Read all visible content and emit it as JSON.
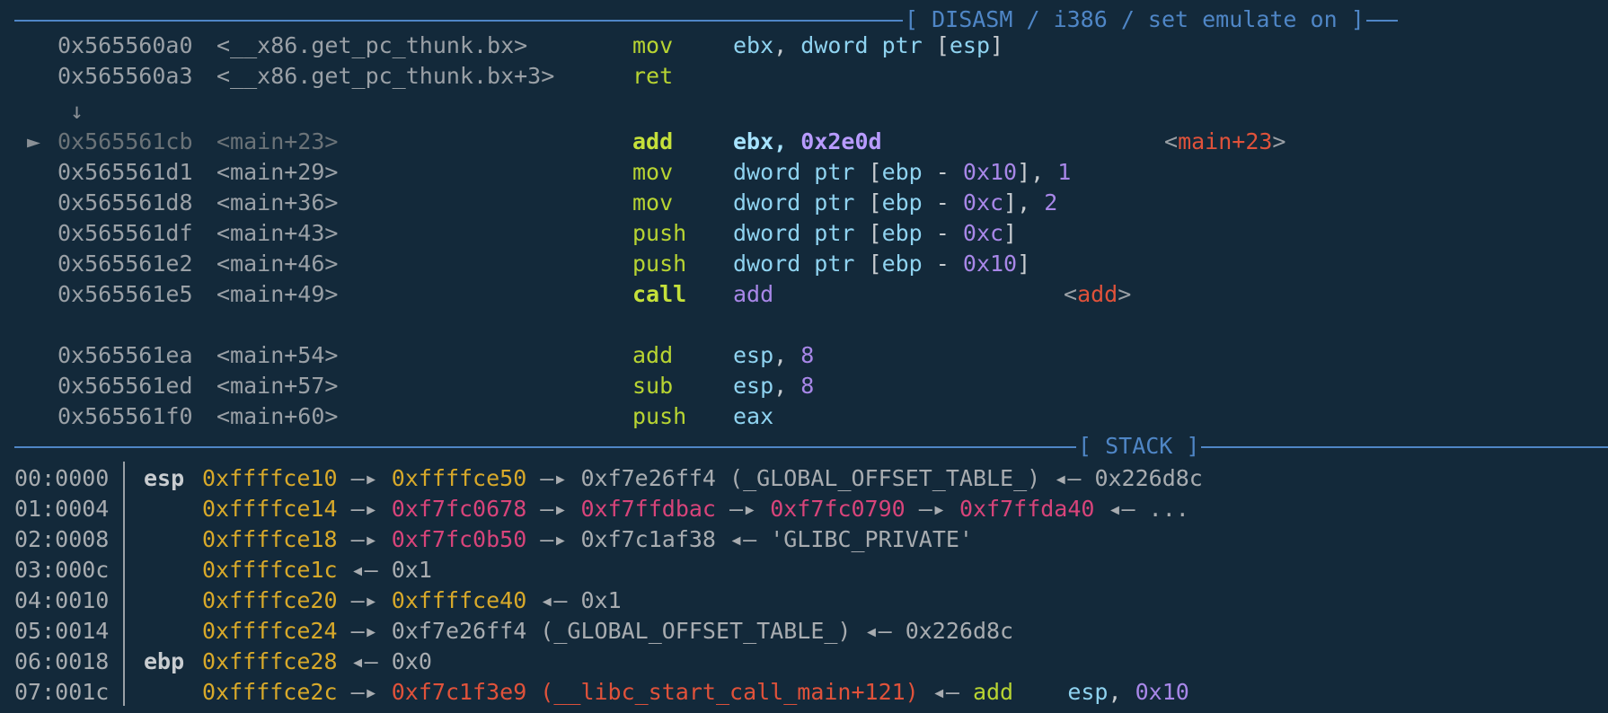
{
  "disasm": {
    "header": "[ DISASM / i386 / set emulate on ]",
    "branch_arrow": "↓",
    "cursor_marker": "►",
    "lines": [
      {
        "addr": "0x565560a0",
        "sym": "<__x86.get_pc_thunk.bx>",
        "mn": "mov",
        "ops": [
          [
            "reg",
            "ebx"
          ],
          [
            "plain",
            ", "
          ],
          [
            "kw",
            "dword ptr "
          ],
          [
            "plain",
            "["
          ],
          [
            "reg",
            "esp"
          ],
          [
            "plain",
            "]"
          ]
        ]
      },
      {
        "addr": "0x565560a3",
        "sym": "<__x86.get_pc_thunk.bx+3>",
        "mn": "ret",
        "ops": []
      },
      {
        "addr": "0x565561cb",
        "sym": "<main+23>",
        "mn": "add",
        "current": true,
        "ops": [
          [
            "regb",
            "ebx"
          ],
          [
            "plainb",
            ", "
          ],
          [
            "numb",
            "0x2e0d"
          ]
        ],
        "annot_l": "<",
        "annot_s": "main+23",
        "annot_r": ">"
      },
      {
        "addr": "0x565561d1",
        "sym": "<main+29>",
        "mn": "mov",
        "ops": [
          [
            "kw",
            "dword ptr "
          ],
          [
            "plain",
            "["
          ],
          [
            "reg",
            "ebp"
          ],
          [
            "plain",
            " - "
          ],
          [
            "num",
            "0x10"
          ],
          [
            "plain",
            "], "
          ],
          [
            "num",
            "1"
          ]
        ]
      },
      {
        "addr": "0x565561d8",
        "sym": "<main+36>",
        "mn": "mov",
        "ops": [
          [
            "kw",
            "dword ptr "
          ],
          [
            "plain",
            "["
          ],
          [
            "reg",
            "ebp"
          ],
          [
            "plain",
            " - "
          ],
          [
            "num",
            "0xc"
          ],
          [
            "plain",
            "], "
          ],
          [
            "num",
            "2"
          ]
        ]
      },
      {
        "addr": "0x565561df",
        "sym": "<main+43>",
        "mn": "push",
        "ops": [
          [
            "kw",
            "dword ptr "
          ],
          [
            "plain",
            "["
          ],
          [
            "reg",
            "ebp"
          ],
          [
            "plain",
            " - "
          ],
          [
            "num",
            "0xc"
          ],
          [
            "plain",
            "]"
          ]
        ]
      },
      {
        "addr": "0x565561e2",
        "sym": "<main+46>",
        "mn": "push",
        "ops": [
          [
            "kw",
            "dword ptr "
          ],
          [
            "plain",
            "["
          ],
          [
            "reg",
            "ebp"
          ],
          [
            "plain",
            " - "
          ],
          [
            "num",
            "0x10"
          ],
          [
            "plain",
            "]"
          ]
        ]
      },
      {
        "addr": "0x565561e5",
        "sym": "<main+49>",
        "mn": "call",
        "callb": true,
        "ops": [
          [
            "num",
            "add"
          ]
        ],
        "annot_l": "<",
        "annot_s": "add",
        "annot_r": ">"
      },
      {
        "addr": "0x565561ea",
        "sym": "<main+54>",
        "mn": "add",
        "ops": [
          [
            "reg",
            "esp"
          ],
          [
            "plain",
            ", "
          ],
          [
            "num",
            "8"
          ]
        ]
      },
      {
        "addr": "0x565561ed",
        "sym": "<main+57>",
        "mn": "sub",
        "ops": [
          [
            "reg",
            "esp"
          ],
          [
            "plain",
            ", "
          ],
          [
            "num",
            "8"
          ]
        ]
      },
      {
        "addr": "0x565561f0",
        "sym": "<main+60>",
        "mn": "push",
        "ops": [
          [
            "reg",
            "eax"
          ]
        ]
      }
    ]
  },
  "stack": {
    "header": "[ STACK ]",
    "rows": [
      {
        "idx": "00:0000",
        "reg": "esp",
        "parts": [
          [
            "yel",
            "0xffffce10"
          ],
          [
            "arrow",
            " —▸ "
          ],
          [
            "yel",
            "0xffffce50"
          ],
          [
            "arrow",
            " —▸ "
          ],
          [
            "gry",
            "0xf7e26ff4 (_GLOBAL_OFFSET_TABLE_)"
          ],
          [
            "arrow",
            " ◂— "
          ],
          [
            "gry",
            "0x226d8c"
          ]
        ]
      },
      {
        "idx": "01:0004",
        "reg": "",
        "parts": [
          [
            "yel",
            "0xffffce14"
          ],
          [
            "arrow",
            " —▸ "
          ],
          [
            "pink",
            "0xf7fc0678"
          ],
          [
            "arrow",
            " —▸ "
          ],
          [
            "pink",
            "0xf7ffdbac"
          ],
          [
            "arrow",
            " —▸ "
          ],
          [
            "pink",
            "0xf7fc0790"
          ],
          [
            "arrow",
            " —▸ "
          ],
          [
            "pink",
            "0xf7ffda40"
          ],
          [
            "arrow",
            " ◂— "
          ],
          [
            "gry",
            "..."
          ]
        ]
      },
      {
        "idx": "02:0008",
        "reg": "",
        "parts": [
          [
            "yel",
            "0xffffce18"
          ],
          [
            "arrow",
            " —▸ "
          ],
          [
            "pink",
            "0xf7fc0b50"
          ],
          [
            "arrow",
            " —▸ "
          ],
          [
            "gry",
            "0xf7c1af38"
          ],
          [
            "arrow",
            " ◂— "
          ],
          [
            "gry",
            "'GLIBC_PRIVATE'"
          ]
        ]
      },
      {
        "idx": "03:000c",
        "reg": "",
        "parts": [
          [
            "yel",
            "0xffffce1c"
          ],
          [
            "arrow",
            " ◂— "
          ],
          [
            "gry",
            "0x1"
          ]
        ]
      },
      {
        "idx": "04:0010",
        "reg": "",
        "parts": [
          [
            "yel",
            "0xffffce20"
          ],
          [
            "arrow",
            " —▸ "
          ],
          [
            "yel",
            "0xffffce40"
          ],
          [
            "arrow",
            " ◂— "
          ],
          [
            "gry",
            "0x1"
          ]
        ]
      },
      {
        "idx": "05:0014",
        "reg": "",
        "parts": [
          [
            "yel",
            "0xffffce24"
          ],
          [
            "arrow",
            " —▸ "
          ],
          [
            "gry",
            "0xf7e26ff4 (_GLOBAL_OFFSET_TABLE_)"
          ],
          [
            "arrow",
            " ◂— "
          ],
          [
            "gry",
            "0x226d8c"
          ]
        ]
      },
      {
        "idx": "06:0018",
        "reg": "ebp",
        "parts": [
          [
            "yel",
            "0xffffce28"
          ],
          [
            "arrow",
            " ◂— "
          ],
          [
            "gry",
            "0x0"
          ]
        ]
      },
      {
        "idx": "07:001c",
        "reg": "",
        "parts": [
          [
            "yel",
            "0xffffce2c"
          ],
          [
            "arrow",
            " —▸ "
          ],
          [
            "red",
            "0xf7c1f3e9 (__libc_start_call_main+121)"
          ],
          [
            "arrow",
            " ◂— "
          ],
          [
            "mn",
            "add"
          ],
          [
            "plain",
            "    "
          ],
          [
            "reg",
            "esp"
          ],
          [
            "plain",
            ", "
          ],
          [
            "num",
            "0x10"
          ]
        ]
      }
    ]
  },
  "colors": {
    "background": "#13293a",
    "rule": "#4f86c6",
    "mnemonic": "#b8d432",
    "register": "#8fd3f0",
    "number": "#a887e8",
    "stack_addr": "#d8a92a",
    "heap_ptr": "#d8447a",
    "code_ptr": "#e0523a"
  }
}
